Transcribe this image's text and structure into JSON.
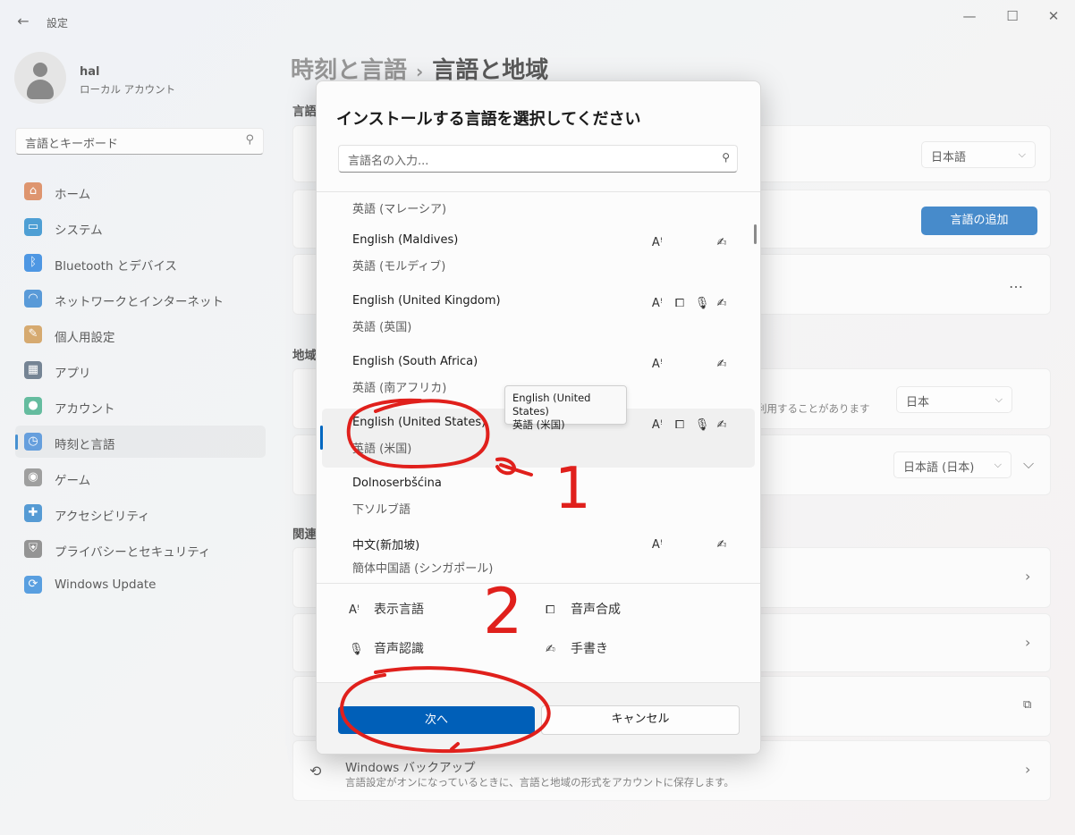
{
  "window": {
    "title": "設定",
    "back_icon": "arrow-left-icon",
    "minimize": "—",
    "maximize": "☐",
    "close": "✕"
  },
  "user": {
    "name": "hal",
    "account_type": "ローカル アカウント"
  },
  "sidebar": {
    "search_value": "言語とキーボード",
    "items": [
      {
        "label": "ホーム",
        "icon": "home-icon",
        "color": "#d16d38",
        "glyph": "⌂"
      },
      {
        "label": "システム",
        "icon": "system-icon",
        "color": "#0a7bc4",
        "glyph": "▭"
      },
      {
        "label": "Bluetooth とデバイス",
        "icon": "bluetooth-icon",
        "color": "#0a6fd8",
        "glyph": "ᛒ"
      },
      {
        "label": "ネットワークとインターネット",
        "icon": "wifi-icon",
        "color": "#1a73c9",
        "glyph": "◠"
      },
      {
        "label": "個人用設定",
        "icon": "brush-icon",
        "color": "#c78a3a",
        "glyph": "✎"
      },
      {
        "label": "アプリ",
        "icon": "apps-icon",
        "color": "#41556b",
        "glyph": "▦"
      },
      {
        "label": "アカウント",
        "icon": "account-icon",
        "color": "#2aa37a",
        "glyph": "●"
      },
      {
        "label": "時刻と言語",
        "icon": "time-language-icon",
        "color": "#2b7bd0",
        "glyph": "◷"
      },
      {
        "label": "ゲーム",
        "icon": "game-icon",
        "color": "#7a7a7a",
        "glyph": "◉"
      },
      {
        "label": "アクセシビリティ",
        "icon": "accessibility-icon",
        "color": "#1675c4",
        "glyph": "✚"
      },
      {
        "label": "プライバシーとセキュリティ",
        "icon": "shield-icon",
        "color": "#6b6b6b",
        "glyph": "⛨"
      },
      {
        "label": "Windows Update",
        "icon": "update-icon",
        "color": "#1a7ad4",
        "glyph": "⟳"
      }
    ],
    "selected_index": 7
  },
  "main": {
    "breadcrumb_parent": "時刻と言語",
    "breadcrumb_current": "言語と地域",
    "section_language": "言語",
    "section_region": "地域",
    "section_related": "関連",
    "display_language_value": "日本語",
    "add_language_button": "言語の追加",
    "more_dots": "…",
    "region_note": "利用することがあります",
    "region_value": "日本",
    "format_value": "日本語 (日本)",
    "backup_title": "Windows バックアップ",
    "backup_desc": "言語設定がオンになっているときに、言語と地域の形式をアカウントに保存します。"
  },
  "dialog": {
    "title": "インストールする言語を選択してください",
    "search_placeholder": "言語名の入力...",
    "languages": [
      {
        "name": "",
        "sub": "英語 (マレーシア)",
        "features": [
          "display",
          "handwriting"
        ]
      },
      {
        "name": "English (Maldives)",
        "sub": "英語 (モルディブ)",
        "features": [
          "display",
          "handwriting"
        ]
      },
      {
        "name": "English (United Kingdom)",
        "sub": "英語 (英国)",
        "features": [
          "display",
          "tts",
          "speech",
          "handwriting"
        ]
      },
      {
        "name": "English (South Africa)",
        "sub": "英語 (南アフリカ)",
        "features": [
          "display",
          "handwriting"
        ]
      },
      {
        "name": "English (United States)",
        "sub": "英語 (米国)",
        "features": [
          "display",
          "tts",
          "speech",
          "handwriting"
        ]
      },
      {
        "name": "Dolnoserbšćina",
        "sub": "下ソルブ語",
        "features": []
      },
      {
        "name": "中文(新加坡)",
        "sub": "簡体中国語 (シンガポール)",
        "features": [
          "display",
          "handwriting"
        ]
      }
    ],
    "selected_index": 4,
    "tooltip_line1": "English (United States)",
    "tooltip_line2": "英語 (米国)",
    "legend": {
      "display": "表示言語",
      "tts": "音声合成",
      "speech": "音声認識",
      "handwriting": "手書き"
    },
    "next_button": "次へ",
    "cancel_button": "キャンセル"
  },
  "annotations": {
    "color": "#e0201c",
    "mark1": "1",
    "mark2": "2"
  }
}
